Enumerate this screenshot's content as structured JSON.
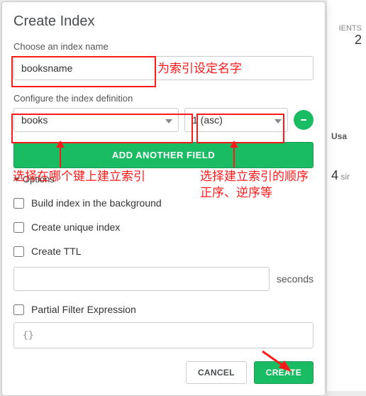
{
  "backdrop": {
    "clients_label": "IENTS",
    "clients_value": "2",
    "col1": "Usa",
    "stat1": "4",
    "stat1_suffix": "sir"
  },
  "modal": {
    "title": "Create Index",
    "name_label": "Choose an index name",
    "name_value": "booksname",
    "def_label": "Configure the index definition",
    "field_value": "books",
    "order_value": "1 (asc)",
    "add_field": "ADD ANOTHER FIELD",
    "options_toggle": "Options",
    "opt_background": "Build index in the background",
    "opt_unique": "Create unique index",
    "opt_ttl": "Create TTL",
    "seconds_unit": "seconds",
    "opt_partial": "Partial Filter Expression",
    "partial_placeholder": "{}",
    "cancel": "CANCEL",
    "create": "CREATE"
  },
  "annotations": {
    "name_note": "为索引设定名字",
    "field_note": "选择在哪个键上建立索引",
    "order_note": "选择建立索引的顺序\n正序、逆序等"
  }
}
